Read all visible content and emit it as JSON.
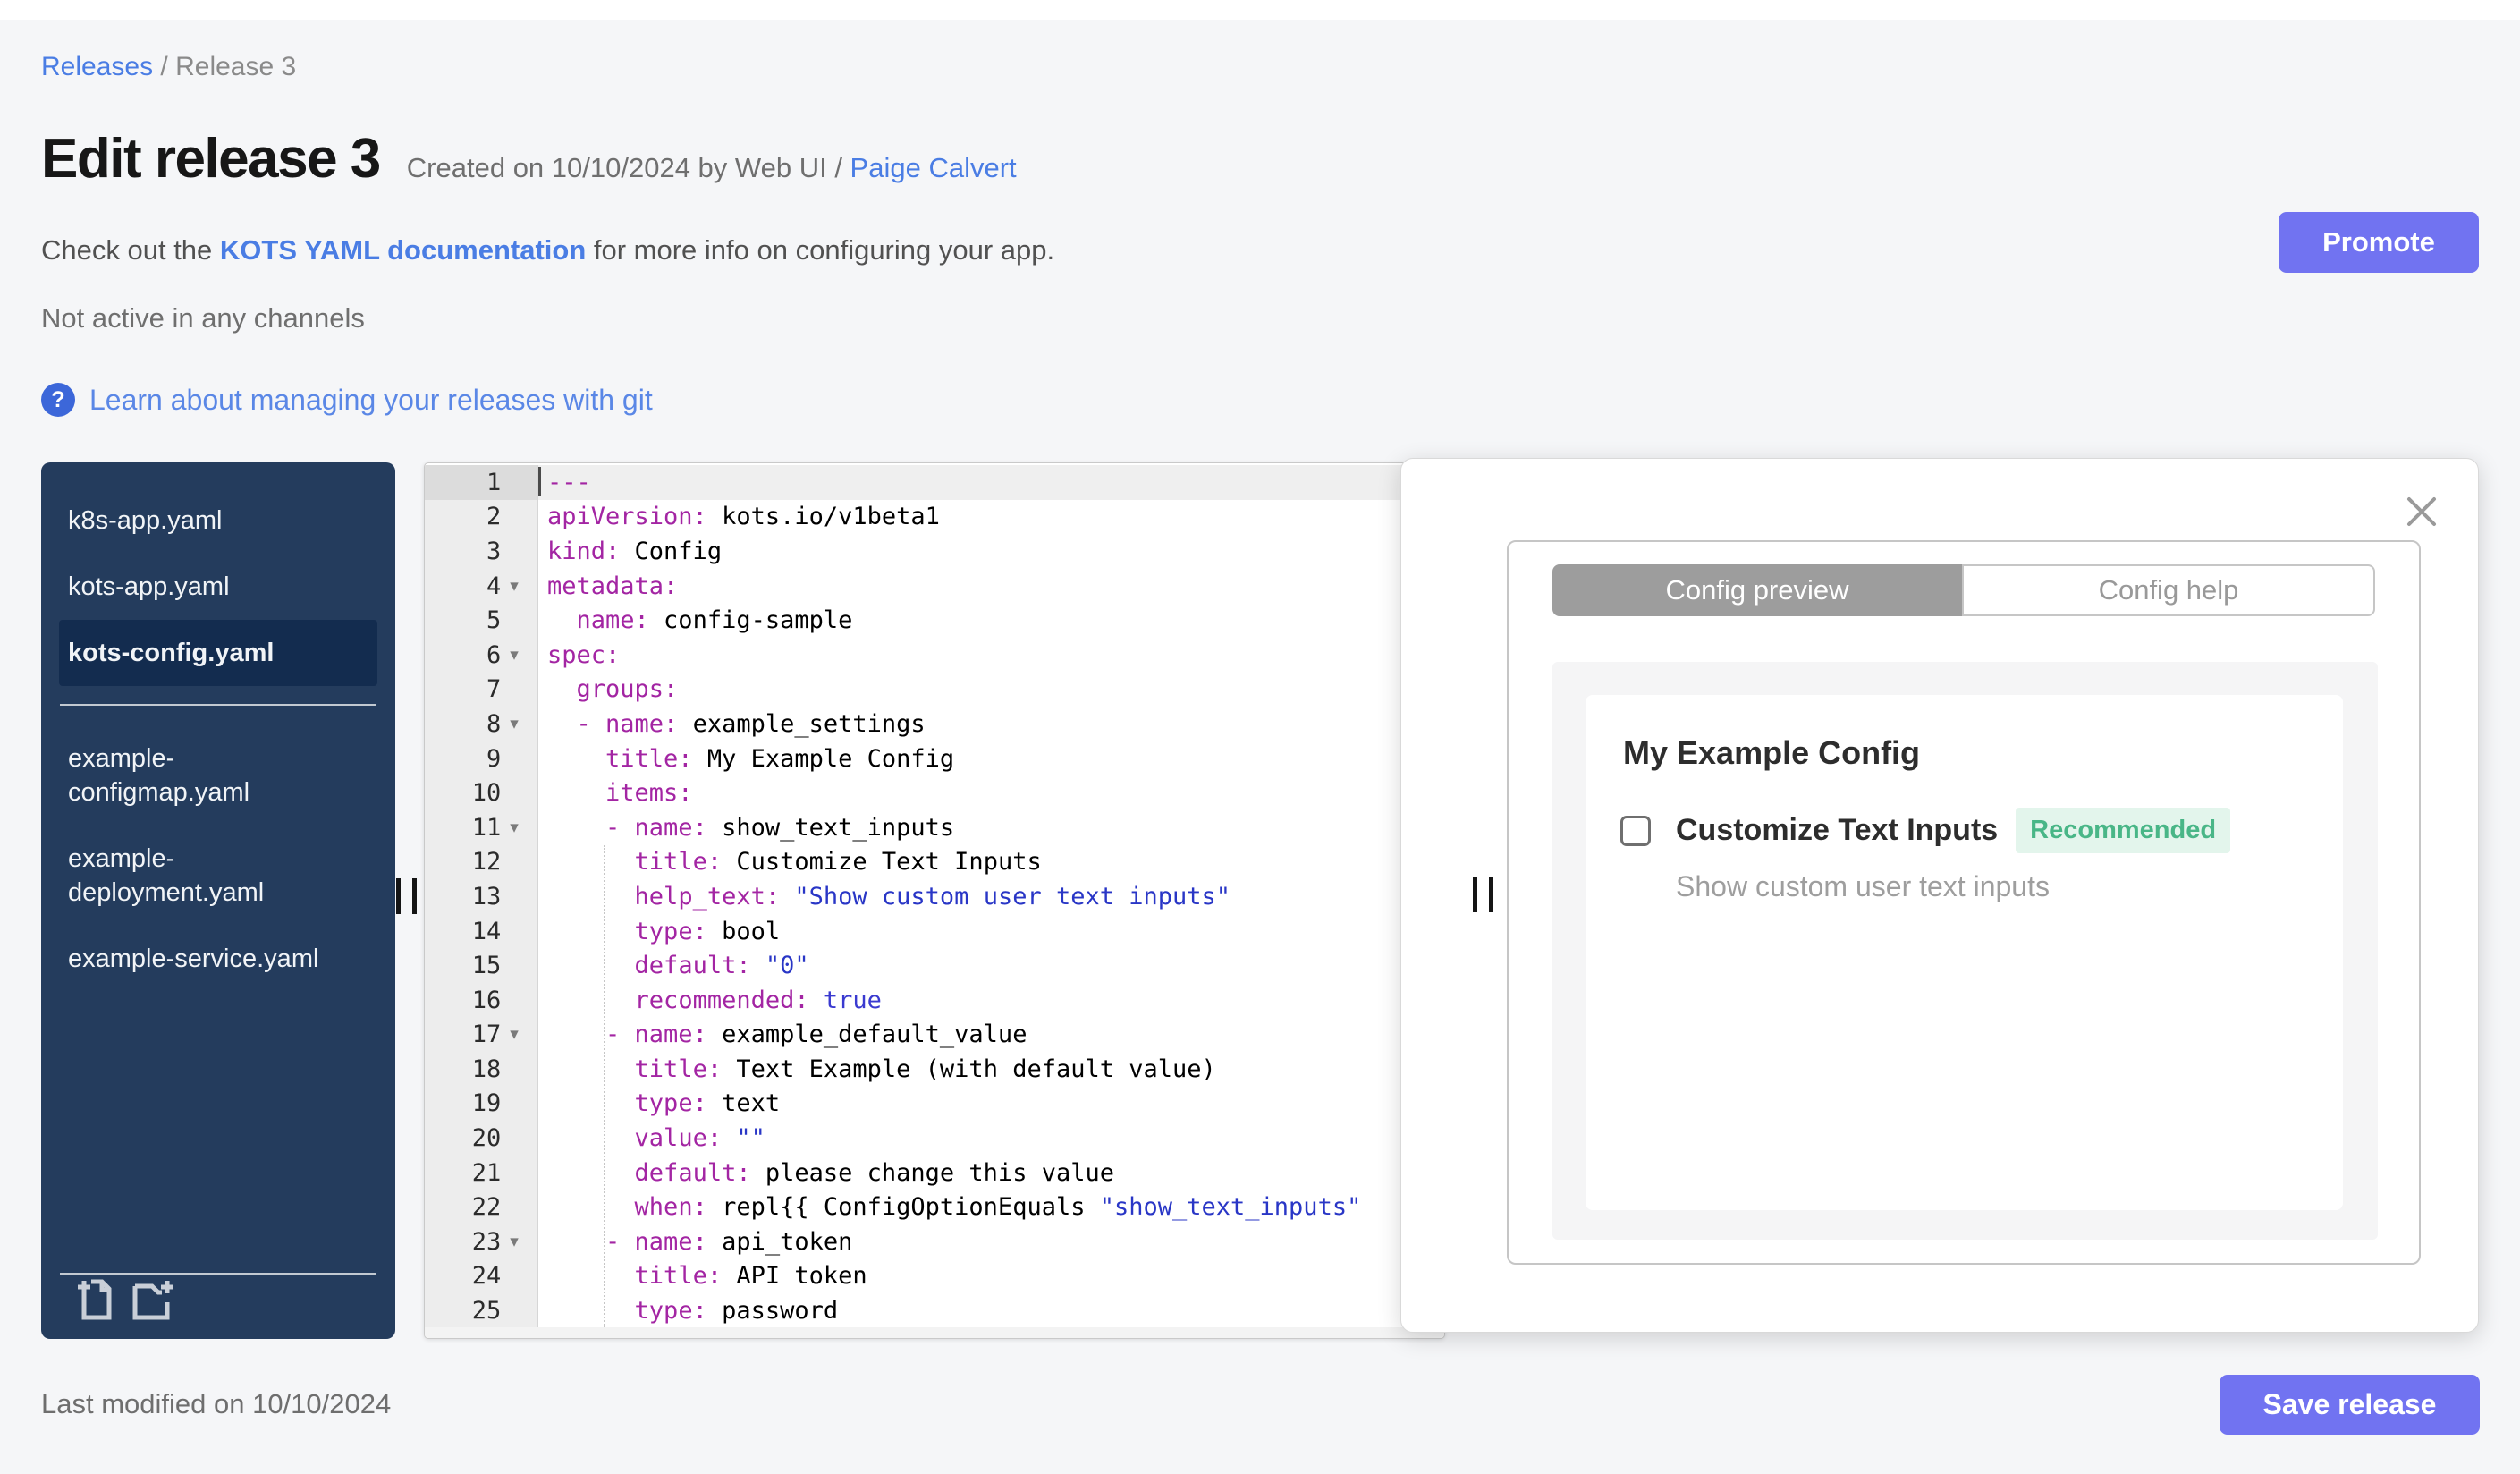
{
  "breadcrumb": {
    "link": "Releases",
    "separator": " / ",
    "current": "Release 3"
  },
  "header": {
    "title": "Edit release 3",
    "created_prefix": "Created on 10/10/2024 by Web UI / ",
    "created_link": "Paige Calvert",
    "doc_prefix": "Check out the ",
    "doc_link": "KOTS YAML documentation",
    "doc_suffix": " for more info on configuring your app.",
    "channel_status": "Not active in any channels",
    "promote_label": "Promote",
    "help_icon_glyph": "?",
    "git_link": "Learn about managing your releases with git"
  },
  "colors": {
    "accent": "#7173f1",
    "link_blue": "#4a7de4",
    "git_link_blue": "#5a87e6",
    "help_icon_blue": "#3c67d9",
    "sidebar_navy": "#243c5d",
    "sidebar_selected": "#132c4f",
    "badge_green_text": "#49b687",
    "badge_green_bg": "#e3f5ec",
    "code_key": "#a325a3",
    "code_string": "#2936c6",
    "code_keyword": "#3a3ad0",
    "tab_active_bg": "#9d9d9d"
  },
  "file_sidebar": {
    "selected": "kots-config.yaml",
    "groups": [
      [
        "k8s-app.yaml",
        "kots-app.yaml",
        "kots-config.yaml"
      ],
      [
        "example-configmap.yaml",
        "example-deployment.yaml",
        "example-service.yaml"
      ]
    ],
    "icons": [
      "new-file-icon",
      "new-folder-icon"
    ]
  },
  "editor": {
    "active_line": 1,
    "lines": [
      {
        "n": 1,
        "fold": false,
        "seg": [
          [
            "key",
            "---"
          ]
        ]
      },
      {
        "n": 2,
        "fold": false,
        "seg": [
          [
            "key",
            "apiVersion:"
          ],
          [
            "plain",
            " kots.io/v1beta1"
          ]
        ]
      },
      {
        "n": 3,
        "fold": false,
        "seg": [
          [
            "key",
            "kind:"
          ],
          [
            "plain",
            " Config"
          ]
        ]
      },
      {
        "n": 4,
        "fold": true,
        "seg": [
          [
            "key",
            "metadata:"
          ]
        ]
      },
      {
        "n": 5,
        "fold": false,
        "seg": [
          [
            "plain",
            "  "
          ],
          [
            "key",
            "name:"
          ],
          [
            "plain",
            " config-sample"
          ]
        ]
      },
      {
        "n": 6,
        "fold": true,
        "seg": [
          [
            "key",
            "spec:"
          ]
        ]
      },
      {
        "n": 7,
        "fold": false,
        "seg": [
          [
            "plain",
            "  "
          ],
          [
            "key",
            "groups:"
          ]
        ]
      },
      {
        "n": 8,
        "fold": true,
        "seg": [
          [
            "plain",
            "  "
          ],
          [
            "key",
            "- name:"
          ],
          [
            "plain",
            " example_settings"
          ]
        ]
      },
      {
        "n": 9,
        "fold": false,
        "seg": [
          [
            "plain",
            "    "
          ],
          [
            "key",
            "title:"
          ],
          [
            "plain",
            " My Example Config"
          ]
        ]
      },
      {
        "n": 10,
        "fold": false,
        "seg": [
          [
            "plain",
            "    "
          ],
          [
            "key",
            "items:"
          ]
        ]
      },
      {
        "n": 11,
        "fold": true,
        "seg": [
          [
            "plain",
            "    "
          ],
          [
            "key",
            "- name:"
          ],
          [
            "plain",
            " show_text_inputs"
          ]
        ]
      },
      {
        "n": 12,
        "fold": false,
        "seg": [
          [
            "plain",
            "      "
          ],
          [
            "key",
            "title:"
          ],
          [
            "plain",
            " Customize Text Inputs"
          ]
        ]
      },
      {
        "n": 13,
        "fold": false,
        "seg": [
          [
            "plain",
            "      "
          ],
          [
            "key",
            "help_text:"
          ],
          [
            "plain",
            " "
          ],
          [
            "str",
            "\"Show custom user text inputs\""
          ]
        ]
      },
      {
        "n": 14,
        "fold": false,
        "seg": [
          [
            "plain",
            "      "
          ],
          [
            "key",
            "type:"
          ],
          [
            "plain",
            " bool"
          ]
        ]
      },
      {
        "n": 15,
        "fold": false,
        "seg": [
          [
            "plain",
            "      "
          ],
          [
            "key",
            "default:"
          ],
          [
            "plain",
            " "
          ],
          [
            "str",
            "\"0\""
          ]
        ]
      },
      {
        "n": 16,
        "fold": false,
        "seg": [
          [
            "plain",
            "      "
          ],
          [
            "key",
            "recommended:"
          ],
          [
            "plain",
            " "
          ],
          [
            "kw",
            "true"
          ]
        ]
      },
      {
        "n": 17,
        "fold": true,
        "seg": [
          [
            "plain",
            "    "
          ],
          [
            "key",
            "- name:"
          ],
          [
            "plain",
            " example_default_value"
          ]
        ]
      },
      {
        "n": 18,
        "fold": false,
        "seg": [
          [
            "plain",
            "      "
          ],
          [
            "key",
            "title:"
          ],
          [
            "plain",
            " Text Example (with default value)"
          ]
        ]
      },
      {
        "n": 19,
        "fold": false,
        "seg": [
          [
            "plain",
            "      "
          ],
          [
            "key",
            "type:"
          ],
          [
            "plain",
            " text"
          ]
        ]
      },
      {
        "n": 20,
        "fold": false,
        "seg": [
          [
            "plain",
            "      "
          ],
          [
            "key",
            "value:"
          ],
          [
            "plain",
            " "
          ],
          [
            "str",
            "\"\""
          ]
        ]
      },
      {
        "n": 21,
        "fold": false,
        "seg": [
          [
            "plain",
            "      "
          ],
          [
            "key",
            "default:"
          ],
          [
            "plain",
            " please change this value"
          ]
        ]
      },
      {
        "n": 22,
        "fold": false,
        "seg": [
          [
            "plain",
            "      "
          ],
          [
            "key",
            "when:"
          ],
          [
            "plain",
            " repl{{ ConfigOptionEquals "
          ],
          [
            "str",
            "\"show_text_inputs\""
          ]
        ]
      },
      {
        "n": 23,
        "fold": true,
        "seg": [
          [
            "plain",
            "    "
          ],
          [
            "key",
            "- name:"
          ],
          [
            "plain",
            " api_token"
          ]
        ]
      },
      {
        "n": 24,
        "fold": false,
        "seg": [
          [
            "plain",
            "      "
          ],
          [
            "key",
            "title:"
          ],
          [
            "plain",
            " API token"
          ]
        ]
      },
      {
        "n": 25,
        "fold": false,
        "seg": [
          [
            "plain",
            "      "
          ],
          [
            "key",
            "type:"
          ],
          [
            "plain",
            " password"
          ]
        ]
      }
    ]
  },
  "preview_panel": {
    "tabs": [
      {
        "label": "Config preview",
        "active": true
      },
      {
        "label": "Config help",
        "active": false
      }
    ],
    "config": {
      "group_title": "My Example Config",
      "item_label": "Customize Text Inputs",
      "badge": "Recommended",
      "help_text": "Show custom user text inputs",
      "checked": false
    }
  },
  "footer": {
    "last_modified": "Last modified on 10/10/2024",
    "save_label": "Save release"
  }
}
